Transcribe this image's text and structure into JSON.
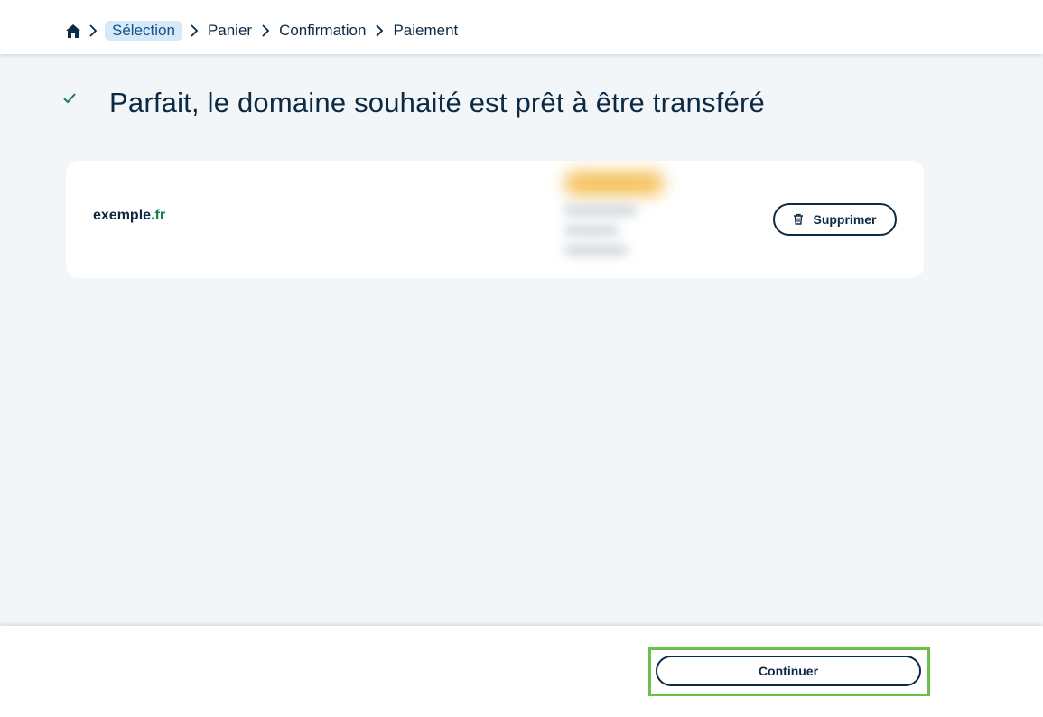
{
  "breadcrumb": {
    "home_icon": "home-icon",
    "items": [
      {
        "label": "Sélection",
        "active": true
      },
      {
        "label": "Panier",
        "active": false
      },
      {
        "label": "Confirmation",
        "active": false
      },
      {
        "label": "Paiement",
        "active": false
      }
    ]
  },
  "main": {
    "check_icon": "checkmark-icon",
    "title": "Parfait, le domaine souhaité est prêt à être transféré"
  },
  "domain_card": {
    "domain_base": "exemple",
    "domain_ext": ".fr",
    "delete_icon": "trash-icon",
    "delete_label": "Supprimer"
  },
  "footer": {
    "continue_label": "Continuer"
  },
  "colors": {
    "primary": "#0d2a45",
    "active_crumb_bg": "#d6e9f8",
    "success": "#13804a",
    "highlight": "#6cc04a",
    "page_bg": "#f2f6f9"
  }
}
